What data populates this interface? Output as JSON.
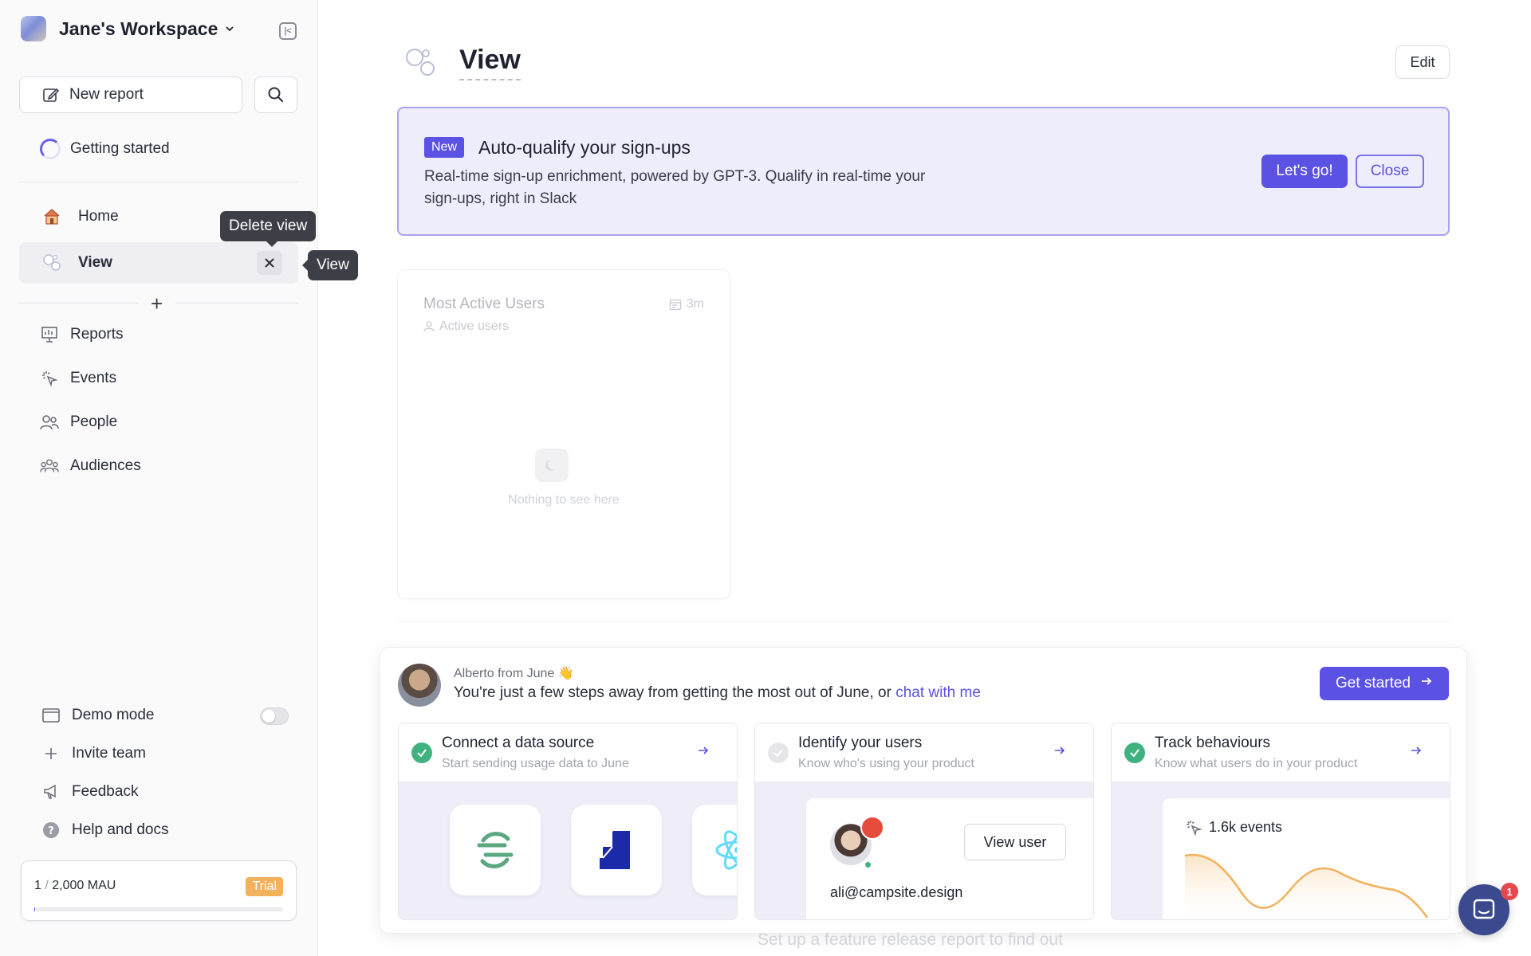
{
  "workspace": {
    "name": "Jane's Workspace"
  },
  "sidebar": {
    "new_report_label": "New report",
    "getting_started_label": "Getting started",
    "pinned": [
      {
        "label": "Home",
        "icon": "house-icon"
      },
      {
        "label": "View",
        "icon": "bubbles-icon",
        "active": true
      }
    ],
    "menu": [
      {
        "label": "Reports",
        "icon": "report-icon"
      },
      {
        "label": "Events",
        "icon": "cursor-click-icon"
      },
      {
        "label": "People",
        "icon": "people-icon"
      },
      {
        "label": "Audiences",
        "icon": "audiences-icon"
      }
    ],
    "footer": [
      {
        "label": "Demo mode",
        "icon": "window-icon"
      },
      {
        "label": "Invite team",
        "icon": "plus-icon"
      },
      {
        "label": "Feedback",
        "icon": "megaphone-icon"
      },
      {
        "label": "Help and docs",
        "icon": "question-icon"
      }
    ],
    "demo_mode_on": false,
    "mau": {
      "used": "1",
      "separator": "/",
      "limit": "2,000 MAU",
      "plan": "Trial"
    }
  },
  "tooltips": {
    "delete_view": "Delete view",
    "view": "View"
  },
  "main": {
    "title": "View",
    "edit_label": "Edit",
    "banner": {
      "badge": "New",
      "title": "Auto-qualify your sign-ups",
      "description": "Real-time sign-up enrichment, powered by GPT-3. Qualify in real-time your sign-ups, right in Slack",
      "primary_label": "Let's go!",
      "secondary_label": "Close"
    },
    "report_card": {
      "title": "Most Active Users",
      "subtitle": "Active users",
      "time_range": "3m",
      "empty_text": "Nothing to see here"
    },
    "onboarding": {
      "from": "Alberto from June 👋",
      "message": "You're just a few steps away from getting the most out of June, or ",
      "link": "chat with me",
      "cta": "Get started",
      "steps": [
        {
          "title": "Connect a data source",
          "subtitle": "Start sending usage data to June",
          "done": true
        },
        {
          "title": "Identify your users",
          "subtitle": "Know who's using your product",
          "done": false
        },
        {
          "title": "Track behaviours",
          "subtitle": "Know what users do in your product",
          "done": true
        }
      ],
      "view_user_label": "View user",
      "user_email": "ali@campsite.design",
      "events_label": "1.6k events"
    },
    "footer_hint": "Set up a feature release report to find out"
  },
  "chat": {
    "unread": "1"
  },
  "colors": {
    "accent": "#5b51e3",
    "success": "#3fb27f",
    "trial": "#f2b15b",
    "chart_line": "#f2b15b"
  }
}
